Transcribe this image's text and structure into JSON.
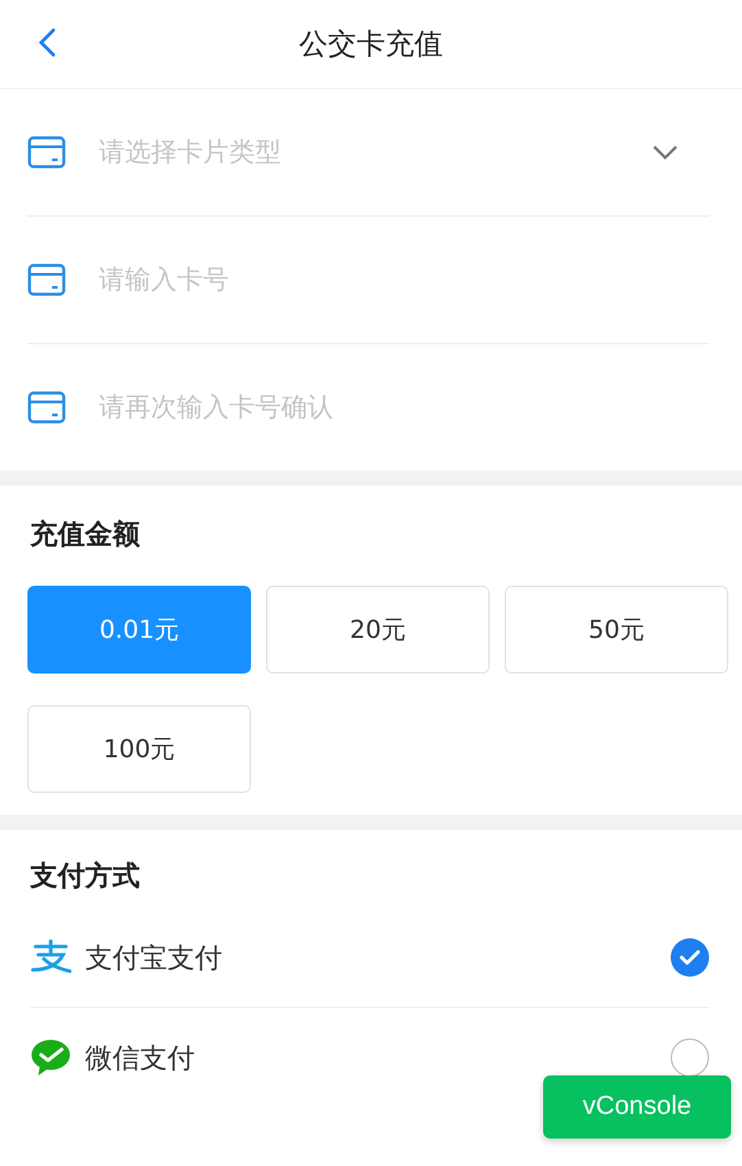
{
  "header": {
    "title": "公交卡充值"
  },
  "fields": [
    {
      "kind": "select",
      "placeholder": "请选择卡片类型"
    },
    {
      "kind": "input",
      "placeholder": "请输入卡号"
    },
    {
      "kind": "input",
      "placeholder": "请再次输入卡号确认"
    }
  ],
  "amount_section": {
    "title": "充值金额",
    "options": [
      {
        "label": "0.01元",
        "selected": true
      },
      {
        "label": "20元",
        "selected": false
      },
      {
        "label": "50元",
        "selected": false
      },
      {
        "label": "100元",
        "selected": false
      }
    ]
  },
  "payment_section": {
    "title": "支付方式",
    "methods": [
      {
        "kind": "alipay",
        "label": "支付宝支付",
        "selected": true
      },
      {
        "kind": "wechat",
        "label": "微信支付",
        "selected": false
      }
    ]
  },
  "vconsole_button": "vConsole"
}
